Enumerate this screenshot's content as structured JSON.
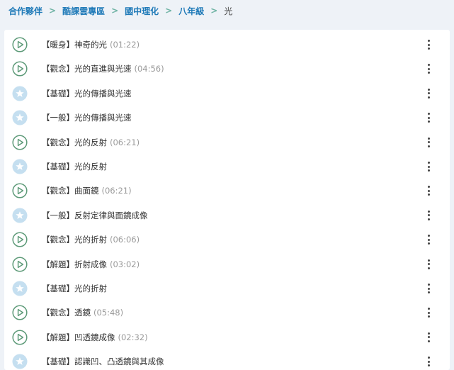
{
  "breadcrumb": [
    {
      "label": "合作夥伴"
    },
    {
      "label": "酷課雲專區"
    },
    {
      "label": "國中理化"
    },
    {
      "label": "八年級"
    },
    {
      "label": "光"
    }
  ],
  "colors": {
    "link": "#1f7ab8",
    "separator": "#6fb3a4",
    "play_icon": "#5d9a78",
    "star_icon_bg": "#c5dff0"
  },
  "items": [
    {
      "icon": "play-icon",
      "tag": "【暖身】",
      "title": "神奇的光",
      "duration": "(01:22)"
    },
    {
      "icon": "play-icon",
      "tag": "【觀念】",
      "title": "光的直進與光速",
      "duration": "(04:56)"
    },
    {
      "icon": "star-icon",
      "tag": "【基礎】",
      "title": "光的傳播與光速",
      "duration": ""
    },
    {
      "icon": "star-icon",
      "tag": "【一般】",
      "title": "光的傳播與光速",
      "duration": ""
    },
    {
      "icon": "play-icon",
      "tag": "【觀念】",
      "title": "光的反射",
      "duration": "(06:21)"
    },
    {
      "icon": "star-icon",
      "tag": "【基礎】",
      "title": "光的反射",
      "duration": ""
    },
    {
      "icon": "play-icon",
      "tag": "【觀念】",
      "title": "曲面鏡",
      "duration": "(06:21)"
    },
    {
      "icon": "star-icon",
      "tag": "【一般】",
      "title": "反射定律與面鏡成像",
      "duration": ""
    },
    {
      "icon": "play-icon",
      "tag": "【觀念】",
      "title": "光的折射",
      "duration": "(06:06)"
    },
    {
      "icon": "play-icon",
      "tag": "【解題】",
      "title": "折射成像",
      "duration": "(03:02)"
    },
    {
      "icon": "star-icon",
      "tag": "【基礎】",
      "title": "光的折射",
      "duration": ""
    },
    {
      "icon": "play-icon",
      "tag": "【觀念】",
      "title": "透鏡",
      "duration": "(05:48)"
    },
    {
      "icon": "play-icon",
      "tag": "【解題】",
      "title": "凹透鏡成像",
      "duration": "(02:32)"
    },
    {
      "icon": "star-icon",
      "tag": "【基礎】",
      "title": "認識凹、凸透鏡與其成像",
      "duration": ""
    }
  ]
}
